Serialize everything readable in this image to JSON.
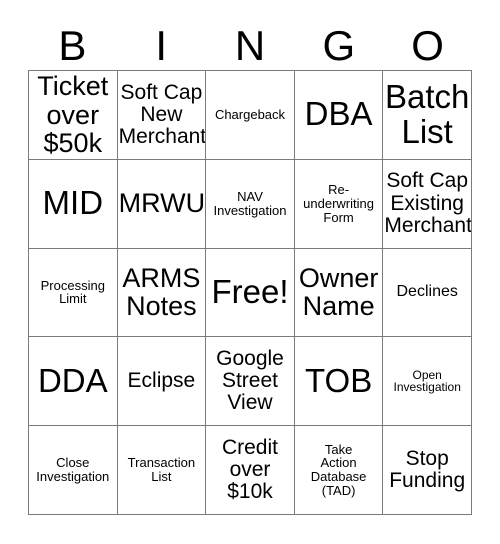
{
  "card": {
    "title": "BINGO Card",
    "header_letters": [
      "B",
      "I",
      "N",
      "G",
      "O"
    ],
    "free_space_label": "Free!",
    "colors": {
      "background": "#ffffff",
      "text": "#000000",
      "grid_line": "#7a7a7a"
    },
    "rows": [
      [
        {
          "label": "Ticket\nover\n$50k",
          "size": "lg"
        },
        {
          "label": "Soft Cap\nNew\nMerchant",
          "size": "md"
        },
        {
          "label": "Chargeback",
          "size": "xs"
        },
        {
          "label": "DBA",
          "size": "xl"
        },
        {
          "label": "Batch\nList",
          "size": "xl"
        }
      ],
      [
        {
          "label": "MID",
          "size": "xl"
        },
        {
          "label": "MRWU",
          "size": "lg"
        },
        {
          "label": "NAV\nInvestigation",
          "size": "xs"
        },
        {
          "label": "Re-\nunderwriting\nForm",
          "size": "xs"
        },
        {
          "label": "Soft Cap\nExisting\nMerchant",
          "size": "md"
        }
      ],
      [
        {
          "label": "Processing\nLimit",
          "size": "xs"
        },
        {
          "label": "ARMS\nNotes",
          "size": "lg"
        },
        {
          "label": "Free!",
          "size": "xl"
        },
        {
          "label": "Owner\nName",
          "size": "lg"
        },
        {
          "label": "Declines",
          "size": "sm"
        }
      ],
      [
        {
          "label": "DDA",
          "size": "xl"
        },
        {
          "label": "Eclipse",
          "size": "md"
        },
        {
          "label": "Google\nStreet\nView",
          "size": "md"
        },
        {
          "label": "TOB",
          "size": "xl"
        },
        {
          "label": "Open\nInvestigation",
          "size": "xxs"
        }
      ],
      [
        {
          "label": "Close\nInvestigation",
          "size": "xs"
        },
        {
          "label": "Transaction\nList",
          "size": "xs"
        },
        {
          "label": "Credit\nover\n$10k",
          "size": "md"
        },
        {
          "label": "Take\nAction\nDatabase\n(TAD)",
          "size": "xs"
        },
        {
          "label": "Stop\nFunding",
          "size": "md"
        }
      ]
    ]
  }
}
